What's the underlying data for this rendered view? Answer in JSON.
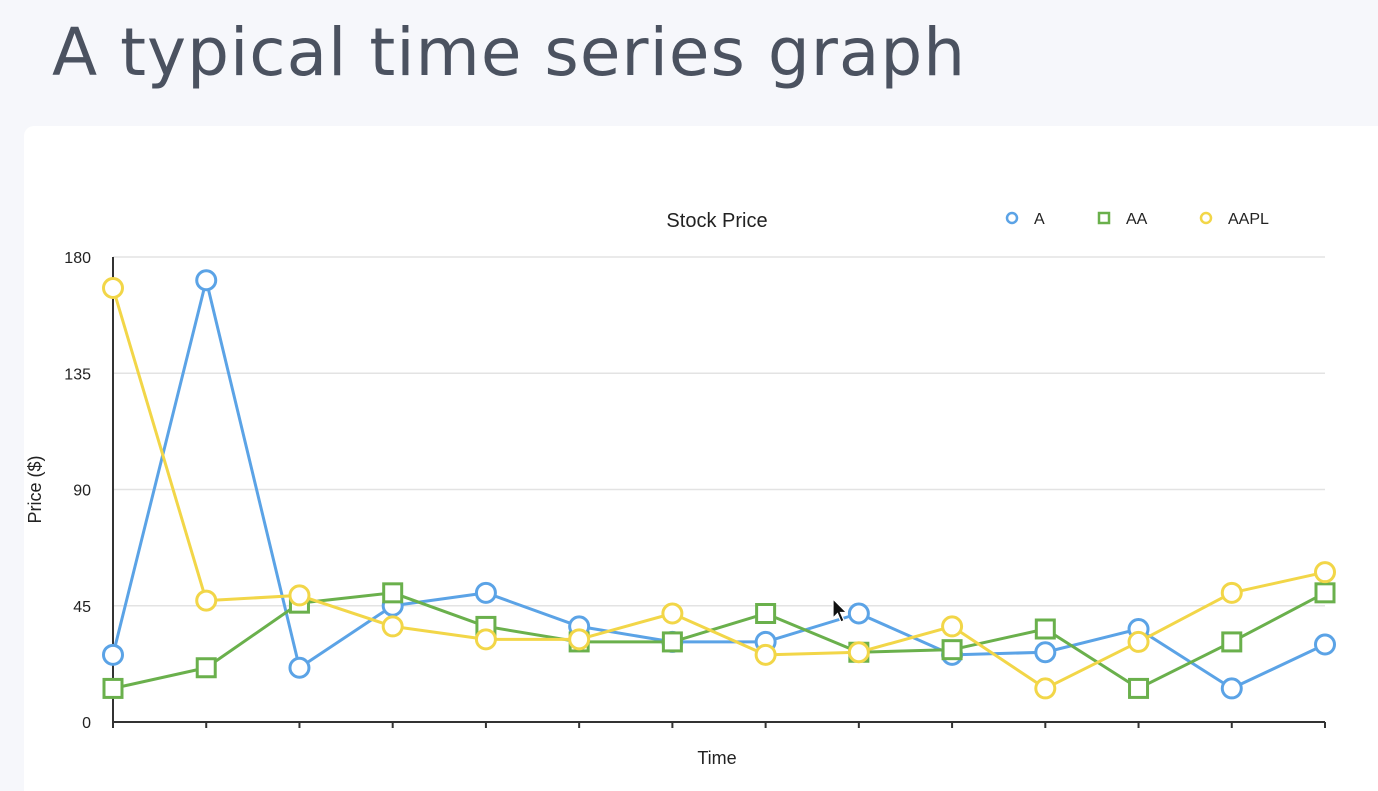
{
  "slide": {
    "title": "A typical time series graph"
  },
  "chart_data": {
    "type": "line",
    "title": "Stock Price",
    "xlabel": "Time",
    "ylabel": "Price ($)",
    "ylim": [
      0,
      180
    ],
    "yticks": [
      "0",
      "45",
      "90",
      "135",
      "180"
    ],
    "grid": true,
    "legend": "top-right",
    "x": [
      1,
      2,
      3,
      4,
      5,
      6,
      7,
      8,
      9,
      10,
      11,
      12,
      13,
      14
    ],
    "series": [
      {
        "name": "A",
        "marker": "circle",
        "color": "#5ba3e6",
        "values": [
          26,
          171,
          21,
          45,
          50,
          37,
          31,
          31,
          42,
          26,
          27,
          36,
          13,
          30
        ]
      },
      {
        "name": "AA",
        "marker": "square",
        "color": "#6ab04c",
        "values": [
          13,
          21,
          46,
          50,
          37,
          31,
          31,
          42,
          27,
          28,
          36,
          13,
          31,
          50
        ]
      },
      {
        "name": "AAPL",
        "marker": "circle",
        "color": "#f2d648",
        "values": [
          168,
          47,
          49,
          37,
          32,
          32,
          42,
          26,
          27,
          37,
          13,
          31,
          50,
          58
        ]
      }
    ]
  }
}
